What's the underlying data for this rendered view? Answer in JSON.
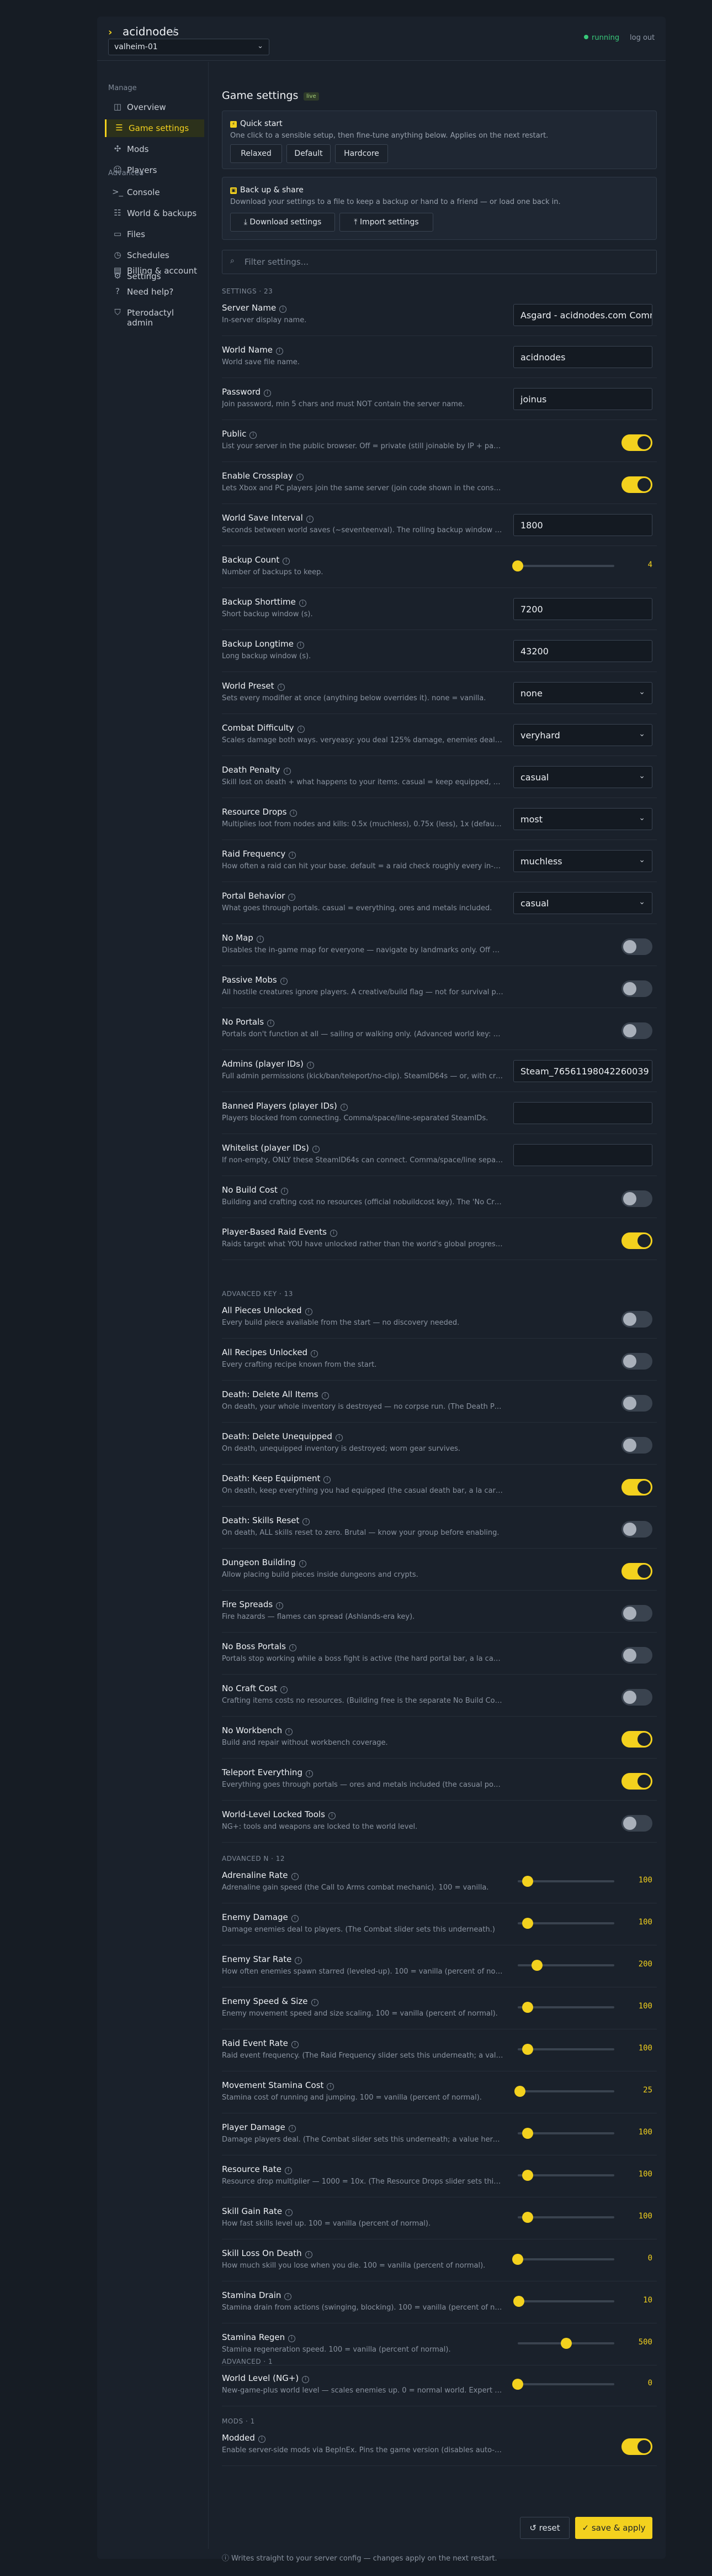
{
  "header": {
    "app_name": "acidnodes",
    "sep": "/",
    "server": "valheim-01",
    "status": "running",
    "logout": "log out"
  },
  "sidebar": {
    "groups": [
      {
        "label": "Manage",
        "items": [
          {
            "label": "Overview",
            "icon": "grid-icon",
            "glyph": "◫",
            "active": false
          },
          {
            "label": "Game settings",
            "icon": "sliders-icon",
            "glyph": "☰",
            "active": true
          },
          {
            "label": "Mods",
            "icon": "puzzle-icon",
            "glyph": "✣",
            "active": false
          },
          {
            "label": "Players",
            "icon": "users-icon",
            "glyph": "☺",
            "active": false
          }
        ]
      },
      {
        "label": "Advanced",
        "items": [
          {
            "label": "Console",
            "icon": "terminal-icon",
            "glyph": ">_",
            "active": false
          },
          {
            "label": "World & backups",
            "icon": "database-icon",
            "glyph": "☷",
            "active": false
          },
          {
            "label": "Files",
            "icon": "folder-icon",
            "glyph": "▭",
            "active": false
          },
          {
            "label": "Schedules",
            "icon": "clock-icon",
            "glyph": "◷",
            "active": false
          },
          {
            "label": "Settings",
            "icon": "gear-icon",
            "glyph": "⚙",
            "active": false
          }
        ]
      },
      {
        "label": "",
        "items": [
          {
            "label": "Billing & account",
            "icon": "card-icon",
            "glyph": "▤",
            "active": false
          },
          {
            "label": "Need help?",
            "icon": "help-icon",
            "glyph": "?",
            "active": false
          },
          {
            "label": "Pterodactyl admin",
            "label2": "admin",
            "icon": "shield-icon",
            "glyph": "⛉",
            "active": false
          }
        ]
      }
    ]
  },
  "page": {
    "title": "Game settings",
    "badge": "live"
  },
  "quickstart": {
    "title": "Quick start",
    "sub": "One click to a sensible setup, then fine-tune anything below. Applies on the next restart.",
    "buttons": [
      "Relaxed",
      "Default",
      "Hardcore"
    ]
  },
  "backup": {
    "title": "Back up & share",
    "sub": "Download your settings to a file to keep a backup or hand to a friend — or load one back in.",
    "download": "Download settings",
    "import": "Import settings"
  },
  "filter": {
    "placeholder": "Filter settings..."
  },
  "sections": [
    {
      "heading": "SETTINGS · 23",
      "rows": [
        {
          "label": "Server Name",
          "desc": "In-server display name.",
          "type": "text",
          "value": "Asgard - acidnodes.com Comm"
        },
        {
          "label": "World Name",
          "desc": "World save file name.",
          "type": "text",
          "value": "acidnodes"
        },
        {
          "label": "Password",
          "desc": "Join password, min 5 chars and must NOT contain the server name.",
          "type": "text",
          "value": "joinus"
        },
        {
          "label": "Public",
          "desc": "List your server in the public browser. Off = private (still joinable by IP + password).",
          "type": "toggle",
          "on": true
        },
        {
          "label": "Enable Crossplay",
          "desc": "Lets Xbox and PC players join the same server (join code shown in the console).",
          "type": "toggle",
          "on": true
        },
        {
          "label": "World Save Interval",
          "desc": "Seconds between world saves (~seventeenval). The rolling backup window follows this.",
          "type": "text",
          "value": "1800"
        },
        {
          "label": "Backup Count",
          "desc": "Number of backups to keep.",
          "type": "slider",
          "value": 4,
          "min": 4,
          "max": 100,
          "display": "4"
        },
        {
          "label": "Backup Shorttime",
          "desc": "Short backup window (s).",
          "type": "text",
          "value": "7200"
        },
        {
          "label": "Backup Longtime",
          "desc": "Long backup window (s).",
          "type": "text",
          "value": "43200"
        },
        {
          "label": "World Preset",
          "desc": "Sets every modifier at once (anything below overrides it). none = vanilla.",
          "type": "select",
          "value": "none"
        },
        {
          "label": "Combat Difficulty",
          "desc": "Scales damage both ways. veryeasy: you deal 125% damage, enemies deal 50%.",
          "type": "select",
          "value": "veryhard"
        },
        {
          "label": "Death Penalty",
          "desc": "Skill lost on death + what happens to your items. casual = keep equipped, no skill loss.",
          "type": "select",
          "value": "casual"
        },
        {
          "label": "Resource Drops",
          "desc": "Multiplies loot from nodes and kills: 0.5x (muchless), 0.75x (less), 1x (default).",
          "type": "select",
          "value": "most"
        },
        {
          "label": "Raid Frequency",
          "desc": "How often a raid can hit your base. default = a raid check roughly every in-game day.",
          "type": "select",
          "value": "muchless"
        },
        {
          "label": "Portal Behavior",
          "desc": "What goes through portals. casual = everything, ores and metals included.",
          "type": "select",
          "value": "casual"
        },
        {
          "label": "No Map",
          "desc": "Disables the in-game map for everyone — navigate by landmarks only. Off = vanilla map.",
          "type": "toggle",
          "on": false
        },
        {
          "label": "Passive Mobs",
          "desc": "All hostile creatures ignore players. A creative/build flag — not for survival play.",
          "type": "toggle",
          "on": false
        },
        {
          "label": "No Portals",
          "desc": "Portals don't function at all — sailing or walking only. (Advanced world key: noportals)",
          "type": "toggle",
          "on": false
        },
        {
          "label": "Admins (player IDs)",
          "desc": "Full admin permissions (kick/ban/teleport/no-clip). SteamID64s — or, with crossplay on, PlayFab IDs.",
          "type": "text",
          "value": "Steam_76561198042260039"
        },
        {
          "label": "Banned Players (player IDs)",
          "desc": "Players blocked from connecting. Comma/space/line-separated SteamIDs.",
          "type": "text",
          "value": ""
        },
        {
          "label": "Whitelist (player IDs)",
          "desc": "If non-empty, ONLY these SteamID64s can connect. Comma/space/line separated.",
          "type": "text",
          "value": ""
        },
        {
          "label": "No Build Cost",
          "desc": "Building and crafting cost no resources (official nobuildcost key). The 'No Craft Cost' below is separate.",
          "type": "toggle",
          "on": false
        },
        {
          "label": "Player-Based Raid Events",
          "desc": "Raids target what YOU have unlocked rather than the world's global progression.",
          "type": "toggle",
          "on": true
        }
      ]
    },
    {
      "heading": "ADVANCED KEY · 13",
      "rows": [
        {
          "label": "All Pieces Unlocked",
          "desc": "Every build piece available from the start — no discovery needed.",
          "type": "toggle",
          "on": false
        },
        {
          "label": "All Recipes Unlocked",
          "desc": "Every crafting recipe known from the start.",
          "type": "toggle",
          "on": false
        },
        {
          "label": "Death: Delete All Items",
          "desc": "On death, your whole inventory is destroyed — no corpse run. (The Death Penalty above also applies.)",
          "type": "toggle",
          "on": false
        },
        {
          "label": "Death: Delete Unequipped",
          "desc": "On death, unequipped inventory is destroyed; worn gear survives.",
          "type": "toggle",
          "on": false
        },
        {
          "label": "Death: Keep Equipment",
          "desc": "On death, keep everything you had equipped (the casual death bar, a la carte).",
          "type": "toggle",
          "on": true
        },
        {
          "label": "Death: Skills Reset",
          "desc": "On death, ALL skills reset to zero. Brutal — know your group before enabling.",
          "type": "toggle",
          "on": false
        },
        {
          "label": "Dungeon Building",
          "desc": "Allow placing build pieces inside dungeons and crypts.",
          "type": "toggle",
          "on": true
        },
        {
          "label": "Fire Spreads",
          "desc": "Fire hazards — flames can spread (Ashlands-era key).",
          "type": "toggle",
          "on": false
        },
        {
          "label": "No Boss Portals",
          "desc": "Portals stop working while a boss fight is active (the hard portal bar, a la carte).",
          "type": "toggle",
          "on": false
        },
        {
          "label": "No Craft Cost",
          "desc": "Crafting items costs no resources. (Building free is the separate No Build Cost above.)",
          "type": "toggle",
          "on": false
        },
        {
          "label": "No Workbench",
          "desc": "Build and repair without workbench coverage.",
          "type": "toggle",
          "on": true
        },
        {
          "label": "Teleport Everything",
          "desc": "Everything goes through portals — ores and metals included (the casual portal setting).",
          "type": "toggle",
          "on": true
        },
        {
          "label": "World-Level Locked Tools",
          "desc": "NG+: tools and weapons are locked to the world level.",
          "type": "toggle",
          "on": false
        }
      ]
    },
    {
      "heading": "ADVANCED N · 12",
      "rows": [
        {
          "label": "Adrenaline Rate",
          "desc": "Adrenaline gain speed (the Call to Arms combat mechanic). 100 = vanilla.",
          "type": "slider",
          "value": 100,
          "min": 0,
          "max": 1000,
          "display": "100"
        },
        {
          "label": "Enemy Damage",
          "desc": "Damage enemies deal to players. (The Combat slider sets this underneath.)",
          "type": "slider",
          "value": 100,
          "min": 0,
          "max": 1000,
          "display": "100"
        },
        {
          "label": "Enemy Star Rate",
          "desc": "How often enemies spawn starred (leveled-up). 100 = vanilla (percent of normal).",
          "type": "slider",
          "value": 200,
          "min": 0,
          "max": 1000,
          "display": "200"
        },
        {
          "label": "Enemy Speed & Size",
          "desc": "Enemy movement speed and size scaling. 100 = vanilla (percent of normal).",
          "type": "slider",
          "value": 100,
          "min": 0,
          "max": 1000,
          "display": "100"
        },
        {
          "label": "Raid Event Rate",
          "desc": "Raid event frequency. (The Raid Frequency slider sets this underneath; a value here overrides it.)",
          "type": "slider",
          "value": 100,
          "min": 0,
          "max": 1000,
          "display": "100"
        },
        {
          "label": "Movement Stamina Cost",
          "desc": "Stamina cost of running and jumping. 100 = vanilla (percent of normal).",
          "type": "slider",
          "value": 25,
          "min": 0,
          "max": 1000,
          "display": "25"
        },
        {
          "label": "Player Damage",
          "desc": "Damage players deal. (The Combat slider sets this underneath; a value here overrides it.)",
          "type": "slider",
          "value": 100,
          "min": 0,
          "max": 1000,
          "display": "100"
        },
        {
          "label": "Resource Rate",
          "desc": "Resource drop multiplier — 1000 = 10x. (The Resource Drops slider sets this underneath.)",
          "type": "slider",
          "value": 100,
          "min": 0,
          "max": 1000,
          "display": "100"
        },
        {
          "label": "Skill Gain Rate",
          "desc": "How fast skills level up. 100 = vanilla (percent of normal).",
          "type": "slider",
          "value": 100,
          "min": 0,
          "max": 1000,
          "display": "100"
        },
        {
          "label": "Skill Loss On Death",
          "desc": "How much skill you lose when you die. 100 = vanilla (percent of normal).",
          "type": "slider",
          "value": 0,
          "min": 0,
          "max": 1000,
          "display": "0"
        },
        {
          "label": "Stamina Drain",
          "desc": "Stamina drain from actions (swinging, blocking). 100 = vanilla (percent of normal).",
          "type": "slider",
          "value": 10,
          "min": 0,
          "max": 1000,
          "display": "10"
        },
        {
          "label": "Stamina Regen",
          "desc": "Stamina regeneration speed. 100 = vanilla (percent of normal).",
          "type": "slider",
          "value": 500,
          "min": 0,
          "max": 1000,
          "display": "500"
        }
      ]
    },
    {
      "heading": "ADVANCED · 1",
      "rows": [
        {
          "label": "World Level (NG+)",
          "desc": "New-game-plus world level — scales enemies up. 0 = normal world. Expert setting.",
          "type": "slider",
          "value": 0,
          "min": 0,
          "max": 10,
          "display": "0"
        }
      ]
    },
    {
      "heading": "MODS · 1",
      "rows": [
        {
          "label": "Modded",
          "desc": "Enable server-side mods via BepInEx. Pins the game version (disables auto-updates).",
          "type": "toggle",
          "on": true
        }
      ]
    }
  ],
  "actions": {
    "reset": "reset",
    "save": "save & apply"
  },
  "footer": "Writes straight to your server config — changes apply on the next restart.",
  "colors": {
    "accent": "#f3d11e",
    "running": "#38c97a"
  }
}
